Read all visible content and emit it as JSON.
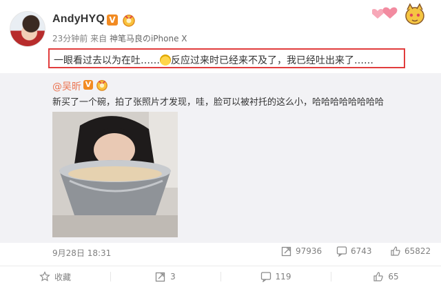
{
  "post": {
    "username": "AndyHYQ",
    "verified_badge": "V",
    "time": "23分钟前",
    "via_prefix": "来自",
    "source": "神笔马良のiPhone X",
    "content_before": "一眼看过去以为在吐……",
    "content_after": "反应过来时已经来不及了，我已经吐出来了……"
  },
  "repost": {
    "username": "@吴昕",
    "verified_badge": "V",
    "text": "新买了一个碗，拍了张照片才发现，哇，脸可以被衬托的这么小，哈哈哈哈哈哈哈哈",
    "date": "9月28日 18:31",
    "reposts": "97936",
    "comments": "6743",
    "likes": "65822"
  },
  "actions": {
    "favorite": "收藏",
    "repost": "3",
    "comment": "119",
    "like": "65"
  },
  "icons": [
    "avatar",
    "verified-icon",
    "medal-icon",
    "hearts-decoration",
    "emoji-icon",
    "repost-icon",
    "comment-icon",
    "like-icon",
    "star-icon"
  ],
  "colors": {
    "highlight_border": "#e13c3c",
    "repost_user": "#eb7350",
    "badge": "#f28b22",
    "repost_bg": "#f2f2f5"
  }
}
